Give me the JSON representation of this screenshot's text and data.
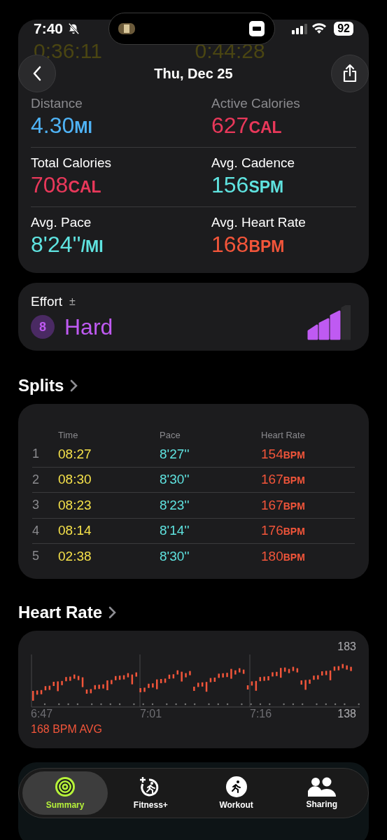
{
  "status_bar": {
    "time": "7:40",
    "silent": true,
    "battery": "92"
  },
  "nav": {
    "title": "Thu, Dec 25"
  },
  "durations_behind": [
    "0:36:11",
    "0:44:28"
  ],
  "metrics": [
    {
      "label": "Distance",
      "value": "4.30",
      "unit": "MI",
      "color": "#4fb3f6"
    },
    {
      "label": "Active Calories",
      "value": "627",
      "unit": "CAL",
      "color": "#e8385a"
    },
    {
      "label": "Total Calories",
      "value": "708",
      "unit": "CAL",
      "color": "#e8385a"
    },
    {
      "label": "Avg. Cadence",
      "value": "156",
      "unit": "SPM",
      "color": "#5fe3e0"
    },
    {
      "label": "Avg. Pace",
      "value": "8'24''",
      "unit": "/MI",
      "color": "#5fe3e0"
    },
    {
      "label": "Avg. Heart Rate",
      "value": "168",
      "unit": "BPM",
      "color": "#f2553a"
    }
  ],
  "effort": {
    "label": "Effort",
    "adjust": "±",
    "score": "8",
    "rating": "Hard",
    "level": 0.75
  },
  "splits": {
    "title": "Splits",
    "columns": [
      "Time",
      "Pace",
      "Heart Rate"
    ],
    "rows": [
      {
        "index": "1",
        "time": "08:27",
        "pace": "8'27''",
        "hr": "154",
        "unit": "BPM"
      },
      {
        "index": "2",
        "time": "08:30",
        "pace": "8'30''",
        "hr": "167",
        "unit": "BPM"
      },
      {
        "index": "3",
        "time": "08:23",
        "pace": "8'23''",
        "hr": "167",
        "unit": "BPM"
      },
      {
        "index": "4",
        "time": "08:14",
        "pace": "8'14''",
        "hr": "176",
        "unit": "BPM"
      },
      {
        "index": "5",
        "time": "02:38",
        "pace": "8'30''",
        "hr": "180",
        "unit": "BPM"
      }
    ]
  },
  "heart_rate": {
    "title": "Heart Rate",
    "max": "183",
    "min": "138",
    "times": [
      "6:47",
      "7:01",
      "7:16"
    ],
    "average": "168 BPM AVG"
  },
  "tabs": [
    {
      "label": "Summary",
      "kind": "rings",
      "selected": true
    },
    {
      "label": "Fitness+",
      "kind": "fitness",
      "selected": false
    },
    {
      "label": "Workout",
      "kind": "runner",
      "selected": false
    },
    {
      "label": "Sharing",
      "kind": "people",
      "selected": false
    }
  ]
}
